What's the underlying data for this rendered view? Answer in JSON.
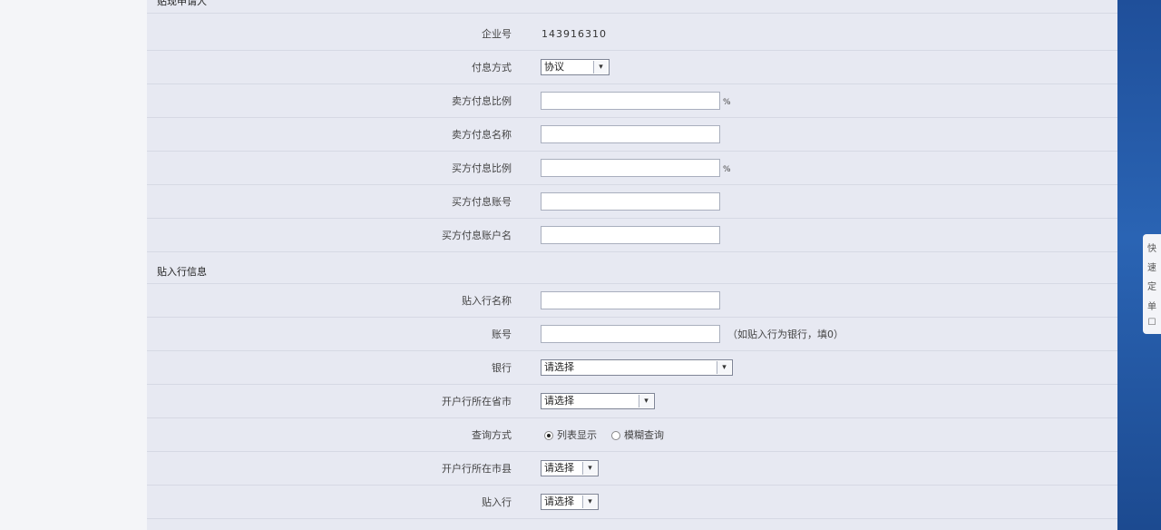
{
  "sections": {
    "applicant": "贴现申请人",
    "bank_info": "贴入行信息"
  },
  "fields": {
    "enterprise_no": {
      "label": "企业号",
      "value": "143916310"
    },
    "interest_method": {
      "label": "付息方式",
      "value": "协议"
    },
    "seller_interest_ratio": {
      "label": "卖方付息比例",
      "suffix": "%"
    },
    "seller_interest_name": {
      "label": "卖方付息名称"
    },
    "buyer_interest_ratio": {
      "label": "买方付息比例",
      "suffix": "%"
    },
    "buyer_interest_account": {
      "label": "买方付息账号"
    },
    "buyer_interest_account_name": {
      "label": "买方付息账户名"
    },
    "discount_bank_name": {
      "label": "贴入行名称"
    },
    "account_no": {
      "label": "账号",
      "hint": "（如贴入行为银行，填0）"
    },
    "bank": {
      "label": "银行",
      "value": "请选择"
    },
    "branch_province": {
      "label": "开户行所在省市",
      "value": "请选择"
    },
    "query_method": {
      "label": "查询方式",
      "options": [
        "列表显示",
        "模糊查询"
      ],
      "selected": "列表显示"
    },
    "branch_city": {
      "label": "开户行所在市县",
      "value": "请选择"
    },
    "discount_bank": {
      "label": "贴入行",
      "value": "请选择"
    }
  },
  "side_float": {
    "chars": [
      "快",
      "速",
      "定",
      "单",
      "☐"
    ]
  },
  "icons": {
    "dropdown": "chevron-down-icon"
  }
}
